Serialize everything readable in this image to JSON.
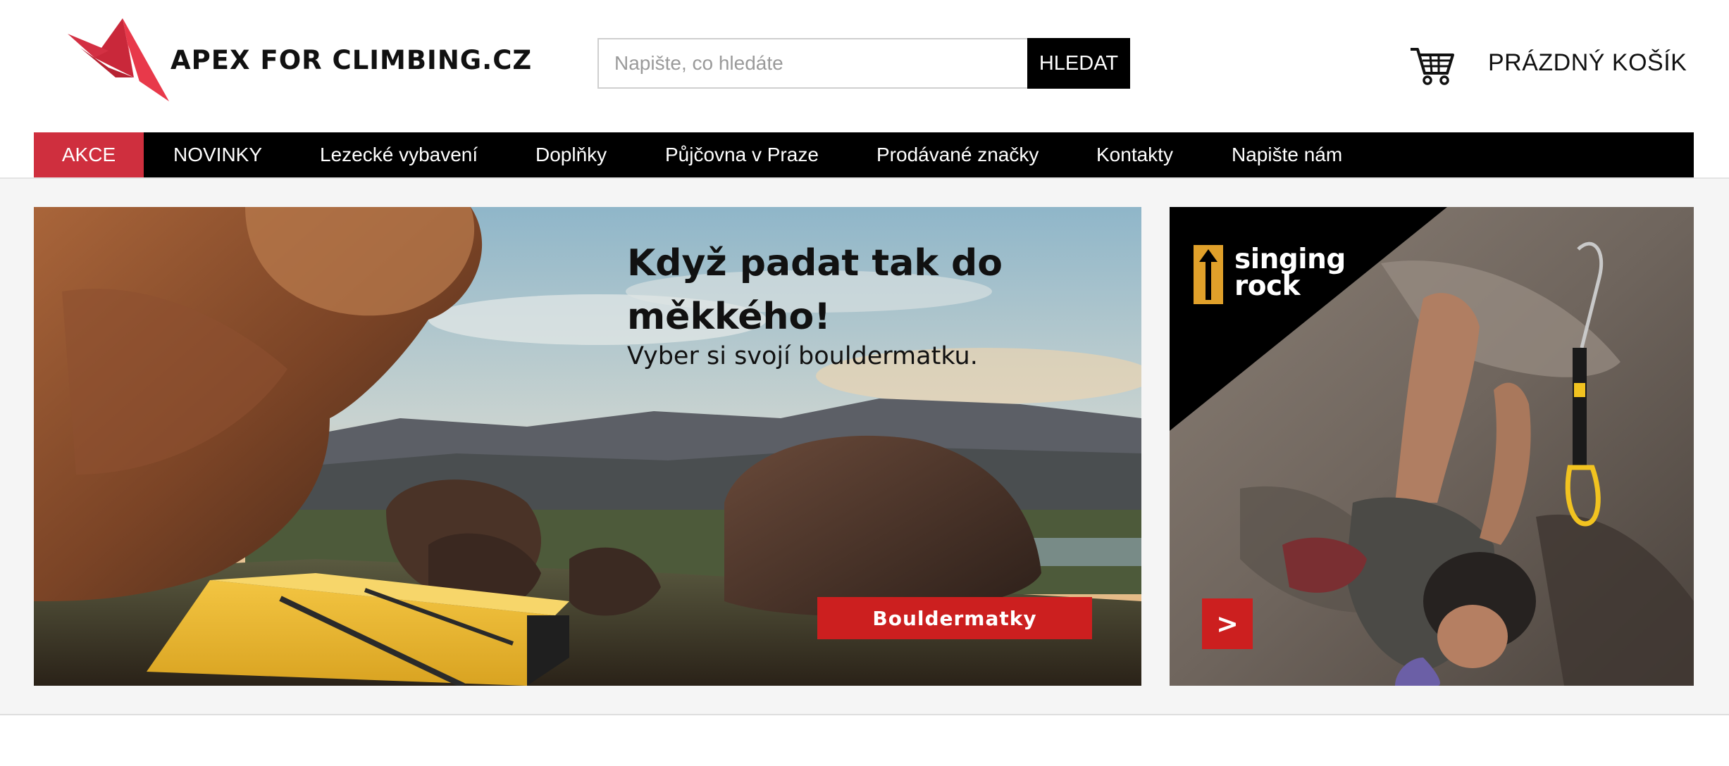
{
  "header": {
    "logo_text": "APEX FOR CLIMBING.CZ",
    "search": {
      "placeholder": "Napište, co hledáte",
      "value": "",
      "button_label": "HLEDAT"
    },
    "cart": {
      "label": "PRÁZDNÝ KOŠÍK",
      "icon": "shopping-cart-icon"
    }
  },
  "nav": {
    "items": [
      {
        "label": "AKCE",
        "active": true
      },
      {
        "label": "NOVINKY"
      },
      {
        "label": "Lezecké vybavení"
      },
      {
        "label": "Doplňky"
      },
      {
        "label": "Půjčovna v Praze"
      },
      {
        "label": "Prodávané značky"
      },
      {
        "label": "Kontakty"
      },
      {
        "label": "Napište nám"
      }
    ]
  },
  "hero": {
    "title": "Když padat tak do měkkého!",
    "subtitle": "Vyber si svojí bouldermatku.",
    "button_label": "Bouldermatky"
  },
  "side_banner": {
    "brand_line1": "singing",
    "brand_line2": "rock",
    "arrow_label": ">"
  },
  "colors": {
    "accent": "#cf2f3e",
    "nav_bg": "#000000",
    "button_red": "#cc1f1f"
  }
}
